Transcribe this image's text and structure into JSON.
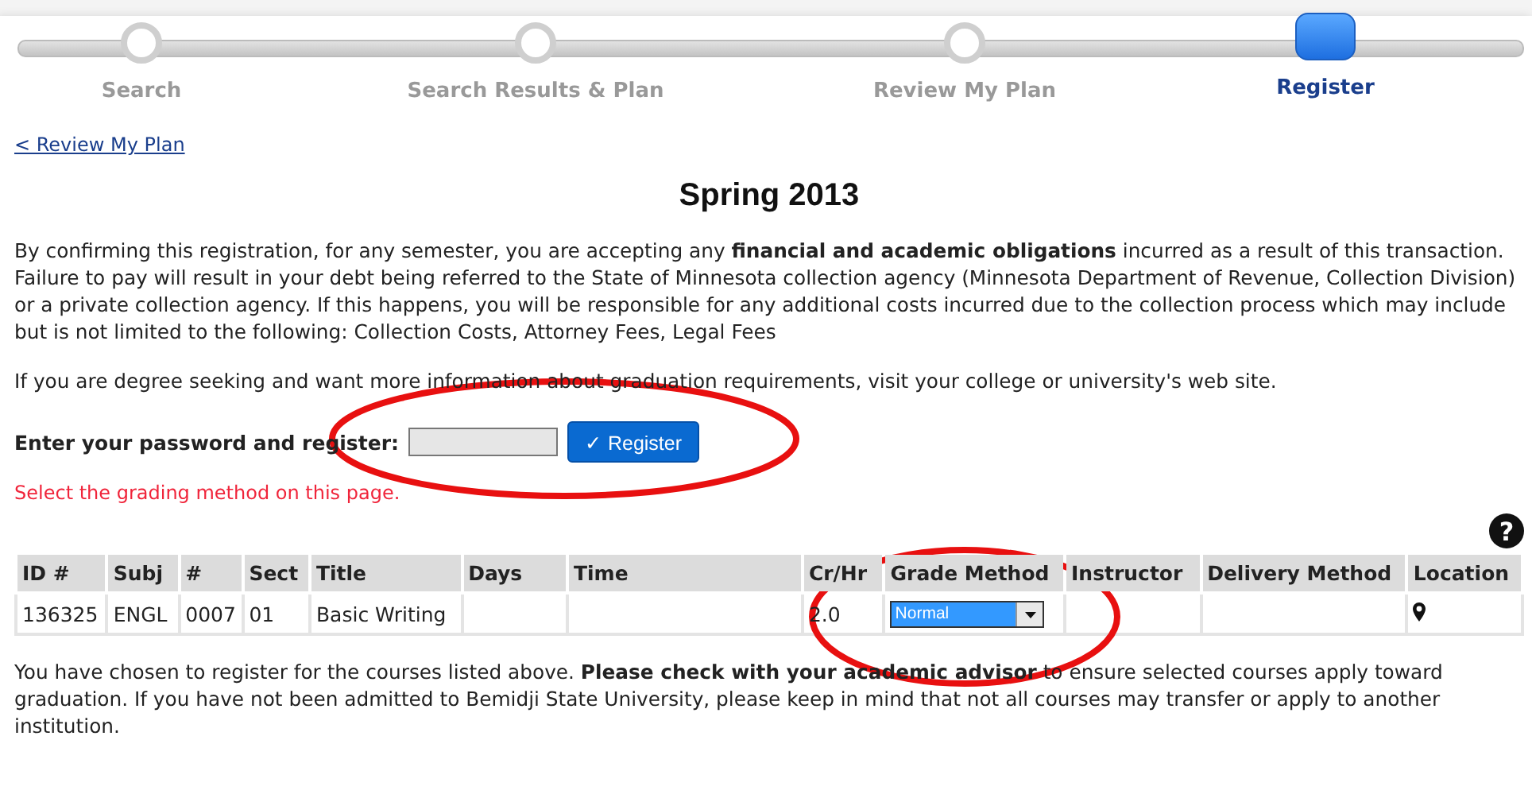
{
  "steps": [
    {
      "label": "Search",
      "selected": false
    },
    {
      "label": "Search Results & Plan",
      "selected": false
    },
    {
      "label": "Review My Plan",
      "selected": false
    },
    {
      "label": "Register",
      "selected": true
    }
  ],
  "back_link": "< Review My Plan",
  "title": "Spring 2013",
  "notice": "By confirming this registration, for any semester, you are accepting any **financial and academic obligations** incurred as a result of this transaction. Failure to pay will result in your debt being referred to the State of Minnesota collection agency (Minnesota Department of Revenue, Collection Division) or a private collection agency. If this happens, you will be responsible for any additional costs incurred due to the collection process which may include but is not limited to the following: Collection Costs, Attorney Fees, Legal Fees",
  "degree_note": "If you are degree seeking and want more information about graduation requirements, visit your college or university's web site.",
  "password": {
    "label": "Enter your password and register:",
    "button": "✓ Register"
  },
  "warning": "Select the grading method on this page.",
  "help": "?",
  "table": {
    "columns": [
      "ID #",
      "Subj",
      "#",
      "Sect",
      "Title",
      "Days",
      "Time",
      "Cr/Hr",
      "Grade Method",
      "Instructor",
      "Delivery Method",
      "Location"
    ],
    "rows": [
      {
        "id": "136325",
        "subj": "ENGL",
        "num": "0007",
        "sect": "01",
        "title": "Basic Writing",
        "cr_hr": "2.0",
        "grade_method": "Normal",
        "has_location": true
      }
    ]
  },
  "footer": "You have chosen to register for the courses listed above. **Please check with your academic advisor** to ensure selected courses apply toward graduation. If you have not been admitted to Bemidji State University, please keep in mind that not all courses may transfer or apply to another institution."
}
